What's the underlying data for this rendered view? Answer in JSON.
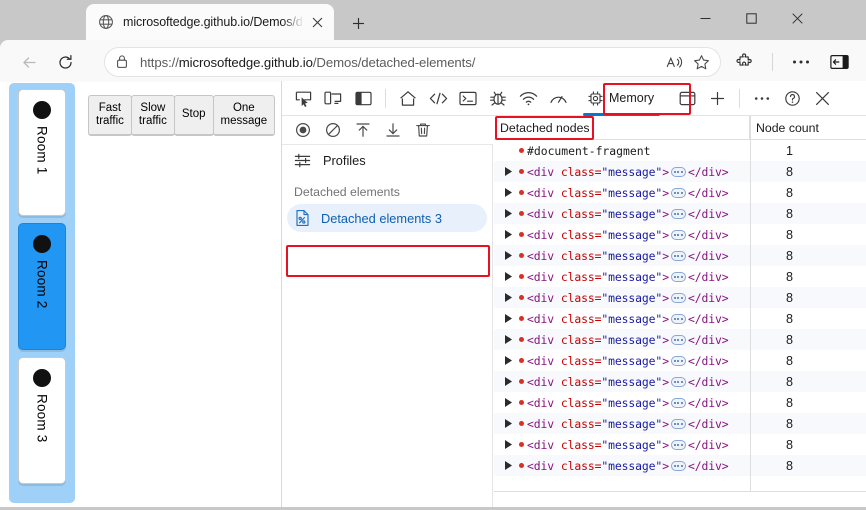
{
  "browser": {
    "tab": {
      "title": "microsoftedge.github.io/Demos/d",
      "favicon_icon": "globe-icon",
      "close_icon": "close-icon"
    },
    "new_tab_icon": "plus-icon",
    "window_controls": {
      "minimize_icon": "minimize-icon",
      "maximize_icon": "maximize-icon",
      "close_icon": "close-icon"
    },
    "nav": {
      "back_icon": "back-arrow-icon",
      "reload_icon": "reload-icon"
    },
    "address_bar": {
      "lock_icon": "lock-icon",
      "url_scheme": "https://",
      "url_host": "microsoftedge.github.io",
      "url_path": "/Demos/detached-elements/",
      "read_aloud_icon": "read-aloud-icon",
      "favorite_icon": "star-icon"
    },
    "extensions_icon": "extensions-puzzle-icon",
    "settings_icon": "more-dots-icon",
    "sidebar_icon": "browser-sidebar-icon"
  },
  "demo": {
    "buttons": [
      {
        "label": "Fast traffic",
        "name": "fast-traffic-button"
      },
      {
        "label": "Slow traffic",
        "name": "slow-traffic-button"
      },
      {
        "label": "Stop",
        "name": "stop-button"
      },
      {
        "label": "One message",
        "name": "one-message-button"
      }
    ],
    "rooms": [
      {
        "label": "Room 1",
        "selected": false
      },
      {
        "label": "Room 2",
        "selected": true
      },
      {
        "label": "Room 3",
        "selected": false
      }
    ]
  },
  "devtools": {
    "toolbar_icons": [
      "inspect-element-icon",
      "device-emulation-icon",
      "dock-side-icon",
      "welcome-home-icon",
      "elements-code-icon",
      "console-icon",
      "sources-debug-icon",
      "network-icon",
      "performance-icon"
    ],
    "active_tab": {
      "label": "Memory",
      "icon": "memory-chip-icon",
      "highlighted": true
    },
    "right_icons": [
      "application-icon",
      "more-tools-plus-icon",
      "more-options-dots-icon",
      "help-question-icon",
      "close-devtools-icon"
    ],
    "accent_color": "#0078d4",
    "highlight_color": "#e81123"
  },
  "memory_panel": {
    "record_toolbar_icons": [
      "record-circle-icon",
      "clear-no-entry-icon",
      "load-profile-icon",
      "save-profile-icon",
      "delete-trash-icon"
    ],
    "profiles_row": {
      "label": "Profiles",
      "icon": "settings-sliders-icon"
    },
    "group_title": "Detached elements",
    "selected_item": {
      "label": "Detached elements 3",
      "icon": "detached-document-icon",
      "highlighted": true
    }
  },
  "table": {
    "headers": {
      "col1": "Detached nodes",
      "col2": "Node count"
    },
    "header_highlighted": true,
    "rows": [
      {
        "type": "fragment",
        "text": "#document-fragment",
        "count": "1",
        "expandable": false
      },
      {
        "type": "element",
        "tag": "div",
        "attr": "class",
        "value": "\"message\"",
        "count": "8",
        "expandable": true
      },
      {
        "type": "element",
        "tag": "div",
        "attr": "class",
        "value": "\"message\"",
        "count": "8",
        "expandable": true
      },
      {
        "type": "element",
        "tag": "div",
        "attr": "class",
        "value": "\"message\"",
        "count": "8",
        "expandable": true
      },
      {
        "type": "element",
        "tag": "div",
        "attr": "class",
        "value": "\"message\"",
        "count": "8",
        "expandable": true
      },
      {
        "type": "element",
        "tag": "div",
        "attr": "class",
        "value": "\"message\"",
        "count": "8",
        "expandable": true
      },
      {
        "type": "element",
        "tag": "div",
        "attr": "class",
        "value": "\"message\"",
        "count": "8",
        "expandable": true
      },
      {
        "type": "element",
        "tag": "div",
        "attr": "class",
        "value": "\"message\"",
        "count": "8",
        "expandable": true
      },
      {
        "type": "element",
        "tag": "div",
        "attr": "class",
        "value": "\"message\"",
        "count": "8",
        "expandable": true
      },
      {
        "type": "element",
        "tag": "div",
        "attr": "class",
        "value": "\"message\"",
        "count": "8",
        "expandable": true
      },
      {
        "type": "element",
        "tag": "div",
        "attr": "class",
        "value": "\"message\"",
        "count": "8",
        "expandable": true
      },
      {
        "type": "element",
        "tag": "div",
        "attr": "class",
        "value": "\"message\"",
        "count": "8",
        "expandable": true
      },
      {
        "type": "element",
        "tag": "div",
        "attr": "class",
        "value": "\"message\"",
        "count": "8",
        "expandable": true
      },
      {
        "type": "element",
        "tag": "div",
        "attr": "class",
        "value": "\"message\"",
        "count": "8",
        "expandable": true
      },
      {
        "type": "element",
        "tag": "div",
        "attr": "class",
        "value": "\"message\"",
        "count": "8",
        "expandable": true
      },
      {
        "type": "element",
        "tag": "div",
        "attr": "class",
        "value": "\"message\"",
        "count": "8",
        "expandable": true
      }
    ]
  }
}
